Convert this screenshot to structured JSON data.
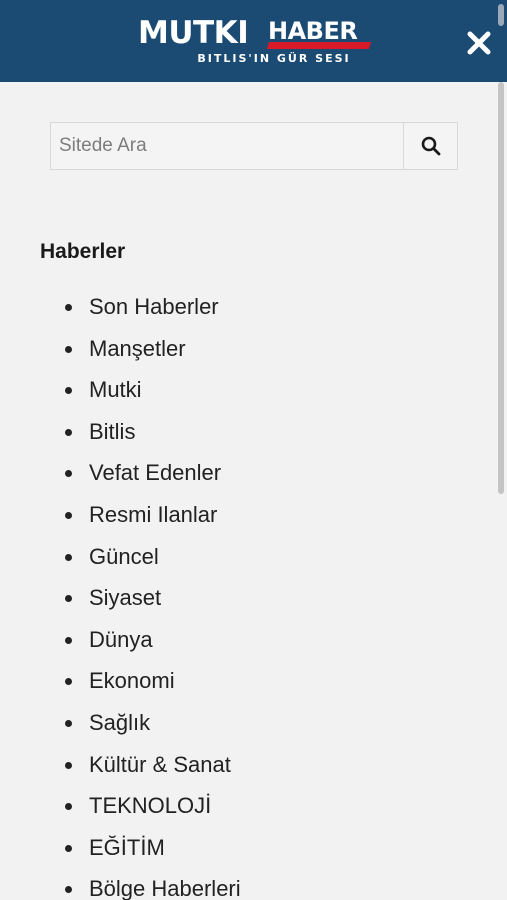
{
  "header": {
    "logo_main": "MUTKI",
    "logo_accent": "HABER",
    "tagline": "BITLIS'IN GÜR SESI"
  },
  "search": {
    "placeholder": "Sitede Ara"
  },
  "menu": {
    "title": "Haberler",
    "items": [
      "Son Haberler",
      "Manşetler",
      "Mutki",
      "Bitlis",
      "Vefat Edenler",
      "Resmi Ilanlar",
      "Güncel",
      "Siyaset",
      "Dünya",
      "Ekonomi",
      "Sağlık",
      "Kültür & Sanat",
      "TEKNOLOJİ",
      "EĞİTİM",
      "Bölge Haberleri"
    ]
  },
  "colors": {
    "header_bg": "#1b4a73",
    "accent_red": "#d7192a",
    "page_bg": "#f2f2f2"
  }
}
